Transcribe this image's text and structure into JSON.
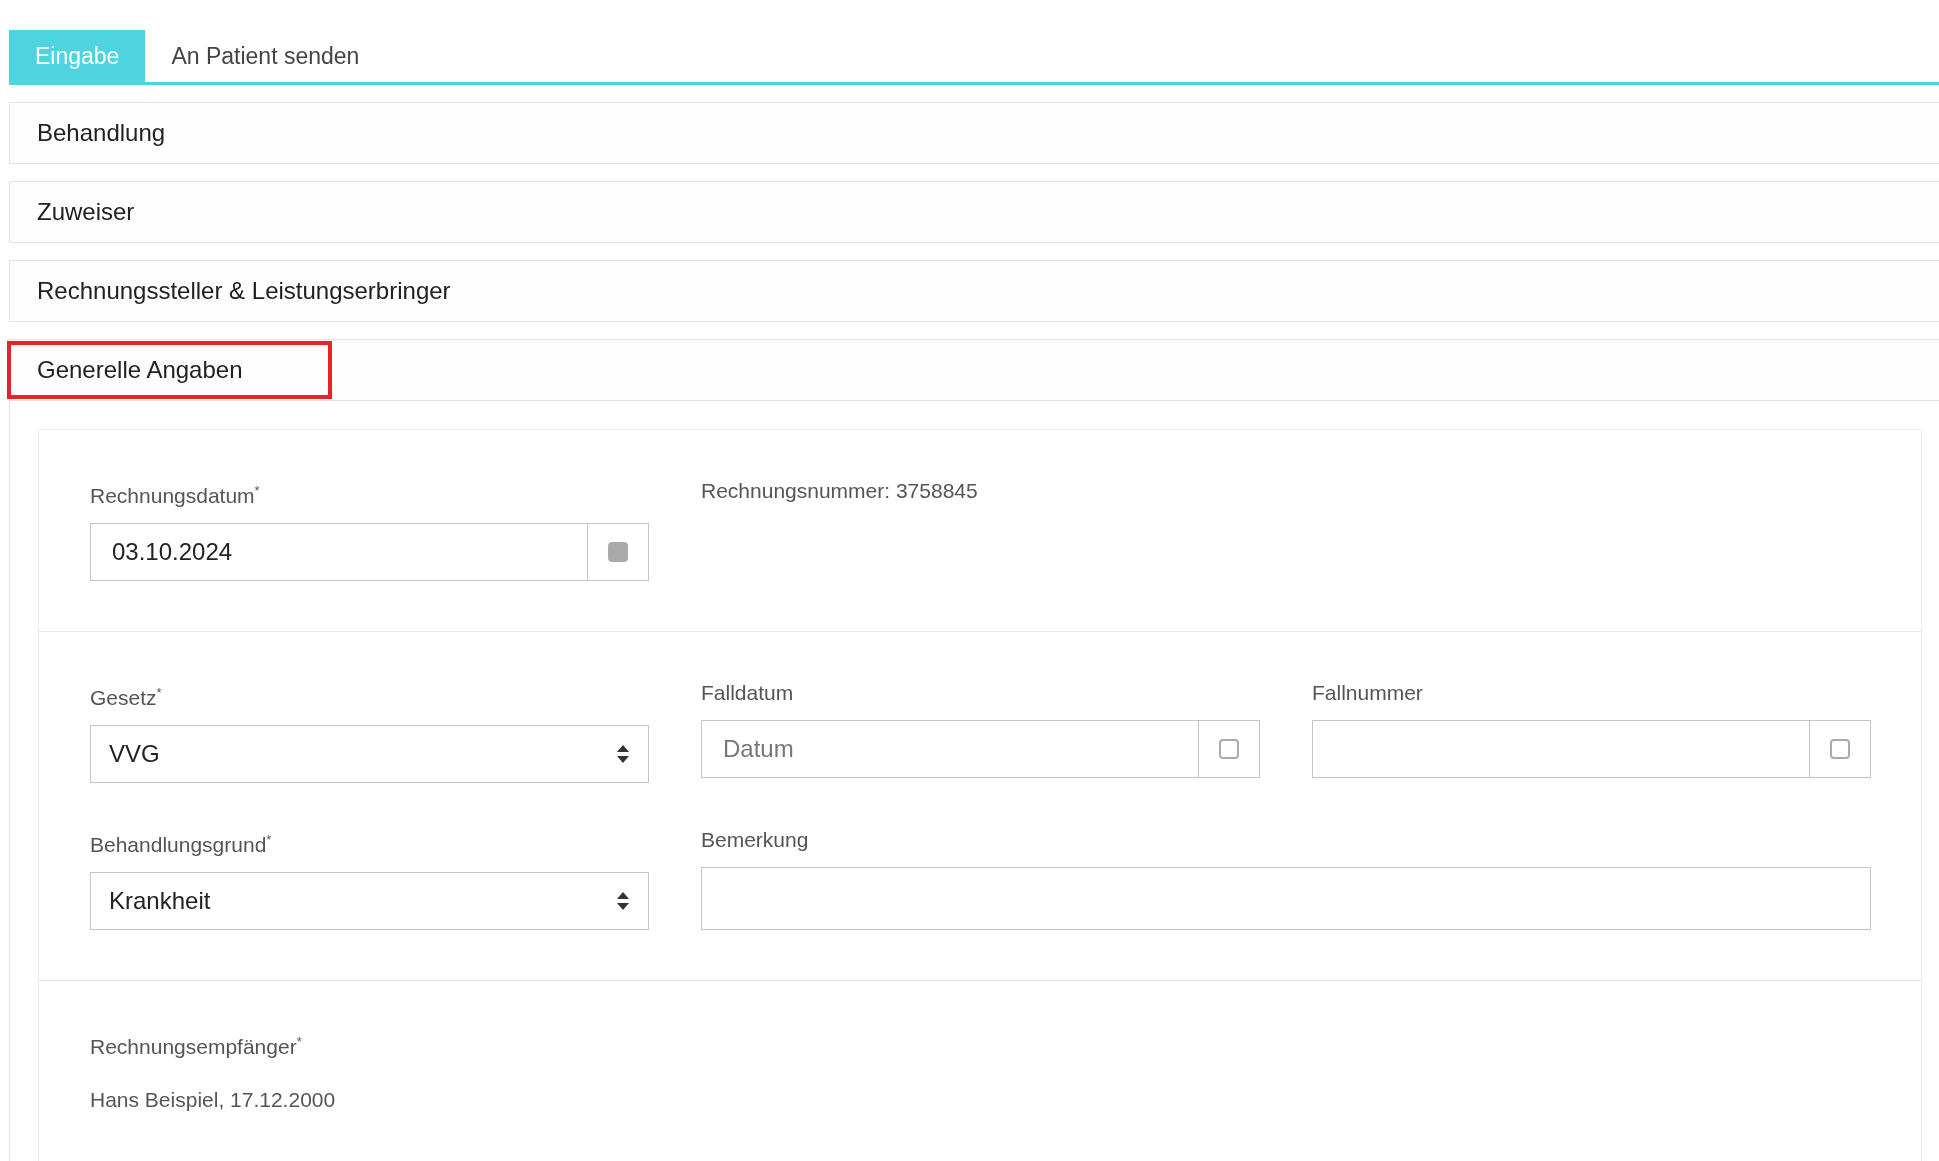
{
  "tabs": [
    {
      "label": "Eingabe",
      "selected": true
    },
    {
      "label": "An Patient senden",
      "selected": false
    }
  ],
  "sections": [
    {
      "title": "Behandlung",
      "expanded": false,
      "highlighted": false
    },
    {
      "title": "Zuweiser",
      "expanded": false,
      "highlighted": false
    },
    {
      "title": "Rechnungssteller & Leistungserbringer",
      "expanded": false,
      "highlighted": false
    },
    {
      "title": "Generelle Angaben",
      "expanded": true,
      "highlighted": true
    }
  ],
  "general": {
    "groups": [
      {
        "fields": [
          {
            "kind": "date",
            "label": "Rechnungsdatum$^{*}$",
            "value": "03.10.2024",
            "addon_filled": true
          },
          {
            "kind": "info",
            "text": "Rechnungsnummer: 3758845"
          }
        ]
      },
      {
        "fields": [
          {
            "kind": "select",
            "label": "Gesetz$^{*}$",
            "value": "VVG"
          },
          {
            "kind": "date",
            "label": "Falldatum",
            "placeholder": "Datum",
            "addon_filled": false
          },
          {
            "kind": "date",
            "label": "Fallnummer",
            "addon_filled": false
          },
          {
            "kind": "select",
            "label": "Behandlungsgrund$^{*}$",
            "value": "Krankheit"
          },
          {
            "kind": "textarea",
            "label": "Bemerkung"
          }
        ]
      },
      {
        "fields": [
          {
            "kind": "static",
            "label": "Rechnungsempfänger$^{*}$",
            "value": "Hans Beispiel, 17.12.2000"
          }
        ]
      }
    ]
  }
}
